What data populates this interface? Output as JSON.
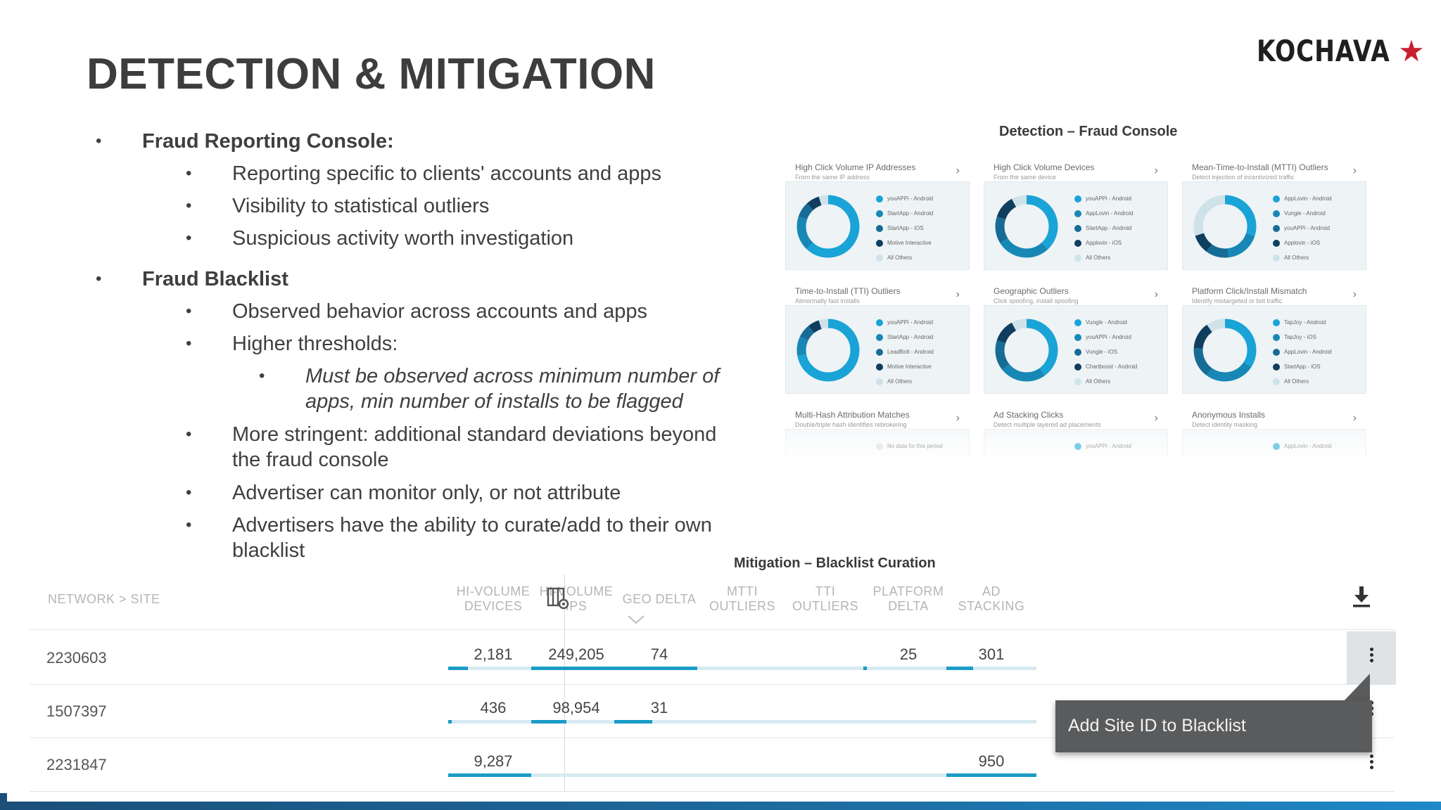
{
  "slide": {
    "title": "DETECTION & MITIGATION",
    "logo_text": "KOCHAVA",
    "logo_star": "★"
  },
  "colors": {
    "accent": "#1a9bc8",
    "brand_star": "#c8202f",
    "dark_blue": "#0d4f73",
    "light_blue": "#bfdbe6"
  },
  "bullets": {
    "b1": "Fraud Reporting Console:",
    "b1_1": "Reporting specific to clients' accounts and apps",
    "b1_2": "Visibility to statistical outliers",
    "b1_3": "Suspicious activity worth investigation",
    "b2": "Fraud Blacklist",
    "b2_1": "Observed behavior across accounts and apps",
    "b2_2": "Higher thresholds:",
    "b2_2_1": "Must be observed across minimum number of apps, min number of installs to be flagged",
    "b2_3": "More stringent: additional standard deviations beyond the fraud console",
    "b2_4": "Advertiser can monitor only, or not attribute",
    "b2_5": "Advertisers have the ability to curate/add to their own blacklist"
  },
  "console": {
    "caption": "Detection – Fraud Console",
    "cards": [
      {
        "title": "High Click Volume IP Addresses",
        "subtitle": "From the same IP address",
        "legend": [
          "youAPPi - Android",
          "StartApp - Android",
          "StartApp - iOS",
          "Motive Interactive",
          "All Others"
        ]
      },
      {
        "title": "High Click Volume Devices",
        "subtitle": "From the same device",
        "legend": [
          "youAPPi - Android",
          "AppLovin - Android",
          "StartApp - Android",
          "Applovin - iOS",
          "All Others"
        ]
      },
      {
        "title": "Mean-Time-to-Install (MTTI) Outliers",
        "subtitle": "Detect injection of incentivized traffic",
        "legend": [
          "AppLovin - Android",
          "Vungle - Android",
          "youAPPi - Android",
          "Applovin - iOS",
          "All Others"
        ]
      },
      {
        "title": "Time-to-Install (TTI) Outliers",
        "subtitle": "Abnormally fast installs",
        "legend": [
          "youAPPi - Android",
          "StartApp - Android",
          "LeadBolt - Android",
          "Motive Interactive",
          "All Others"
        ]
      },
      {
        "title": "Geographic Outliers",
        "subtitle": "Click spoofing, install spoofing",
        "legend": [
          "Vungle - Android",
          "youAPPi - Android",
          "Vungle - iOS",
          "Chartboost - Android",
          "All Others"
        ]
      },
      {
        "title": "Platform Click/Install Mismatch",
        "subtitle": "Identify mistargeted or bot traffic",
        "legend": [
          "TapJoy - Android",
          "TapJoy - iOS",
          "AppLovin - Android",
          "StartApp - iOS",
          "All Others"
        ]
      },
      {
        "title": "Multi-Hash Attribution Matches",
        "subtitle": "Double/triple hash identifies rebrokering",
        "legend": [
          "No data for this period"
        ]
      },
      {
        "title": "Ad Stacking Clicks",
        "subtitle": "Detect multiple layered ad placements",
        "legend": [
          "youAPPi - Android"
        ]
      },
      {
        "title": "Anonymous Installs",
        "subtitle": "Detect identity masking",
        "legend": [
          "AppLovin - Android"
        ]
      }
    ]
  },
  "blacklist": {
    "caption": "Mitigation – Blacklist Curation",
    "first_col": "NETWORK > SITE",
    "columns": [
      "HI-VOLUME\nDEVICES",
      "HI-VOLUME\nIPS",
      "GEO DELTA",
      "MTTI\nOUTLIERS",
      "TTI OUTLIERS",
      "PLATFORM\nDELTA",
      "AD STACKING"
    ],
    "rows": [
      {
        "site": "2230603",
        "cells": [
          "2,181",
          "249,205",
          "74",
          "",
          "",
          "25",
          "301"
        ],
        "fill": [
          0.22,
          1.0,
          1.0,
          0,
          0,
          0.04,
          0.3
        ]
      },
      {
        "site": "1507397",
        "cells": [
          "436",
          "98,954",
          "31",
          "",
          "",
          "",
          ""
        ],
        "fill": [
          0.04,
          0.39,
          0.42,
          0,
          0,
          0,
          0
        ]
      },
      {
        "site": "2231847",
        "cells": [
          "9,287",
          "",
          "",
          "",
          "",
          "",
          "950"
        ],
        "fill": [
          1.0,
          0,
          0,
          0,
          0,
          0,
          1.0
        ]
      }
    ],
    "tooltip": "Add Site ID to Blacklist"
  }
}
